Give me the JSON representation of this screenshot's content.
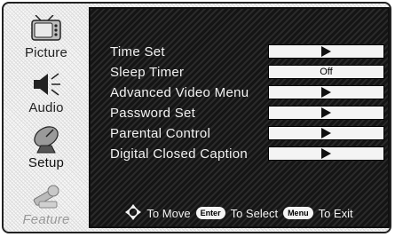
{
  "sidebar": {
    "items": [
      {
        "label": "Picture",
        "icon": "tv-icon"
      },
      {
        "label": "Audio",
        "icon": "speaker-icon"
      },
      {
        "label": "Setup",
        "icon": "satellite-dish-icon"
      },
      {
        "label": "Feature",
        "icon": "tools-icon"
      }
    ]
  },
  "menu": {
    "items": [
      {
        "label": "Time Set",
        "value": ""
      },
      {
        "label": "Sleep Timer",
        "value": "Off"
      },
      {
        "label": "Advanced Video Menu",
        "value": ""
      },
      {
        "label": "Password Set",
        "value": ""
      },
      {
        "label": "Parental Control",
        "value": ""
      },
      {
        "label": "Digital Closed Caption",
        "value": ""
      }
    ]
  },
  "footer": {
    "move_text": "To Move",
    "enter_key": "Enter",
    "select_text": "To Select",
    "menu_key": "Menu",
    "exit_text": "To Exit"
  },
  "colors": {
    "panel_bg": "#1e1e1e",
    "text": "#f2f2f2",
    "value_box": "#f4f4f4"
  }
}
